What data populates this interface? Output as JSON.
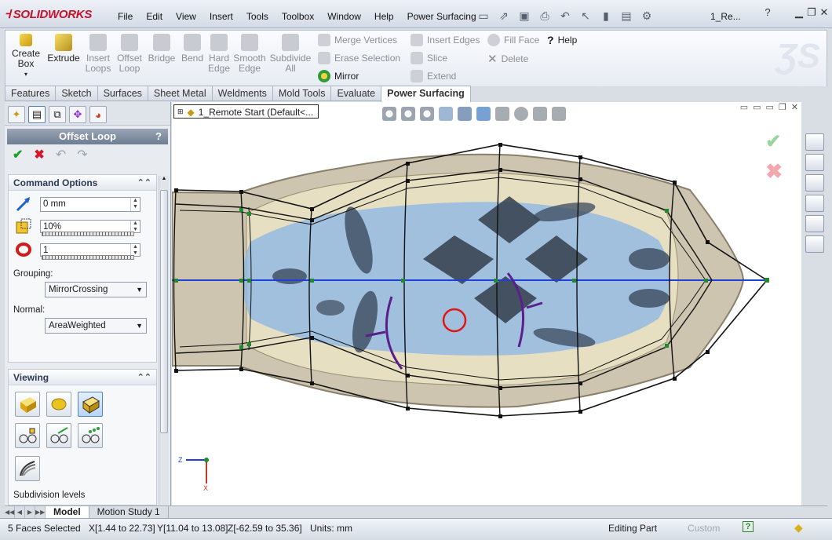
{
  "app": {
    "logo": "SOLIDWORKS",
    "menus": [
      "File",
      "Edit",
      "View",
      "Insert",
      "Tools",
      "Toolbox",
      "Window",
      "Help",
      "Power Surfacing"
    ],
    "doc_title": "1_Re..."
  },
  "ribbon": {
    "big": [
      {
        "label": "Create\nBox",
        "icon": "create-box-icon",
        "enabled": true
      },
      {
        "label": "Extrude",
        "icon": "extrude-icon",
        "enabled": true
      },
      {
        "label": "Insert\nLoops",
        "icon": "insert-loops-icon",
        "enabled": false
      },
      {
        "label": "Offset\nLoop",
        "icon": "offset-loop-icon",
        "enabled": false
      },
      {
        "label": "Bridge",
        "icon": "bridge-icon",
        "enabled": false
      },
      {
        "label": "Bend",
        "icon": "bend-icon",
        "enabled": false
      },
      {
        "label": "Hard\nEdge",
        "icon": "hard-edge-icon",
        "enabled": false
      },
      {
        "label": "Smooth\nEdge",
        "icon": "smooth-edge-icon",
        "enabled": false
      },
      {
        "label": "Subdivide\nAll",
        "icon": "subdivide-all-icon",
        "enabled": false
      }
    ],
    "small": [
      {
        "label": "Merge Vertices",
        "icon": "merge-vertices-icon",
        "enabled": false
      },
      {
        "label": "Erase Selection",
        "icon": "erase-selection-icon",
        "enabled": false
      },
      {
        "label": "Mirror",
        "icon": "mirror-icon",
        "enabled": true
      },
      {
        "label": "Insert Edges",
        "icon": "insert-edges-icon",
        "enabled": false
      },
      {
        "label": "Slice",
        "icon": "slice-icon",
        "enabled": false
      },
      {
        "label": "Extend",
        "icon": "extend-icon",
        "enabled": false
      },
      {
        "label": "Fill Face",
        "icon": "fill-face-icon",
        "enabled": false
      },
      {
        "label": "Delete",
        "icon": "delete-icon",
        "enabled": false
      },
      {
        "label": "Help",
        "icon": "help-icon",
        "enabled": true
      }
    ],
    "tabs": [
      "Features",
      "Sketch",
      "Surfaces",
      "Sheet Metal",
      "Weldments",
      "Mold Tools",
      "Evaluate",
      "Power Surfacing"
    ],
    "active_tab": "Power Surfacing"
  },
  "property_manager": {
    "title": "Offset Loop",
    "help": "?",
    "command_options": {
      "header": "Command Options",
      "distance": "0 mm",
      "percent": "10%",
      "count": "1",
      "grouping_label": "Grouping:",
      "grouping_value": "MirrorCrossing",
      "normal_label": "Normal:",
      "normal_value": "AreaWeighted"
    },
    "viewing": {
      "header": "Viewing",
      "subdivision_label": "Subdivision levels"
    }
  },
  "viewport": {
    "tree_item": "1_Remote Start  (Default<..."
  },
  "bottom_tabs": [
    "Model",
    "Motion Study 1"
  ],
  "status": {
    "selected": "5 Faces Selected",
    "x_range": "X[1.44 to 22.73]",
    "y_range": "Y[11.04 to 13.08]",
    "z_range": "Z[-62.59 to 35.36]",
    "units": "Units: mm",
    "mode": "Editing Part",
    "custom": "Custom"
  },
  "colors": {
    "cage": "#111111",
    "mirror_line": "#1f3fd6",
    "vertex": "#1f8a2a",
    "selection": "#7fb3e6",
    "cursor": "#e01515"
  }
}
